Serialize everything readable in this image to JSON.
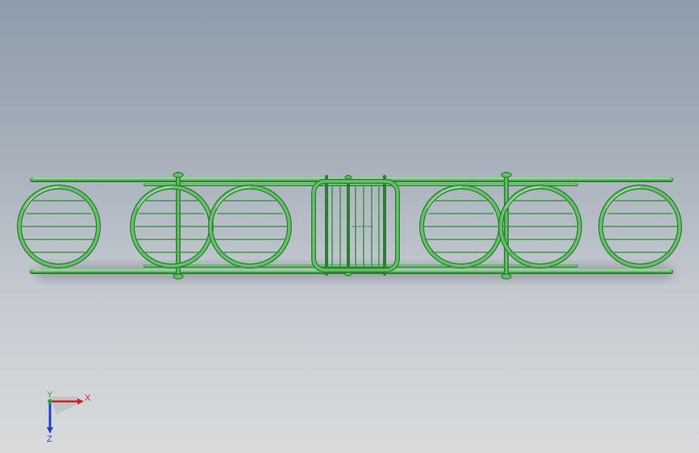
{
  "model": {
    "color": "#5fbf62",
    "edge_color": "#2f7d35",
    "highlight_color": "#aee8ad"
  },
  "triad": {
    "x_label": "X",
    "y_label": "Y",
    "z_label": "Z",
    "x_color": "#d61f1f",
    "y_color": "#2aa62a",
    "z_color": "#1f3fd6"
  }
}
